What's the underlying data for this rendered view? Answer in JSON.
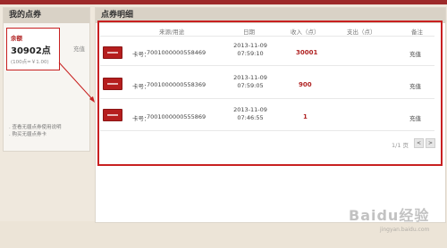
{
  "left": {
    "title": "我的点券",
    "balance_label": "余额",
    "balance_value": "30902点",
    "balance_rate": "(100点=￥1.00)",
    "recharge_label": "充值",
    "notes": [
      ". 查看无疆点券使用说明",
      ". 购买无疆点券卡"
    ]
  },
  "main": {
    "title": "点券明细",
    "columns": [
      "来源/用途",
      "日期",
      "收入（点）",
      "支出（点）",
      "备注"
    ],
    "rows": [
      {
        "card_prefix": "卡号：",
        "card": "7001000000558469",
        "date": "2013-11-09",
        "time": "07:59:10",
        "income": "30001",
        "expense": "",
        "note": "充值"
      },
      {
        "card_prefix": "卡号：",
        "card": "7001000000558369",
        "date": "2013-11-09",
        "time": "07:59:05",
        "income": "900",
        "expense": "",
        "note": "充值"
      },
      {
        "card_prefix": "卡号：",
        "card": "7001000000555869",
        "date": "2013-11-09",
        "time": "07:46:55",
        "income": "1",
        "expense": "",
        "note": "充值"
      }
    ],
    "pager_text": "1/1 页",
    "prev_label": "<",
    "next_label": ">"
  },
  "watermark": {
    "text": "Baidu经验",
    "sub": "jingyan.baidu.com"
  },
  "colors": {
    "accent_red": "#c82020",
    "header_bg": "#d9d2c6",
    "page_bg": "#efe8dd"
  }
}
